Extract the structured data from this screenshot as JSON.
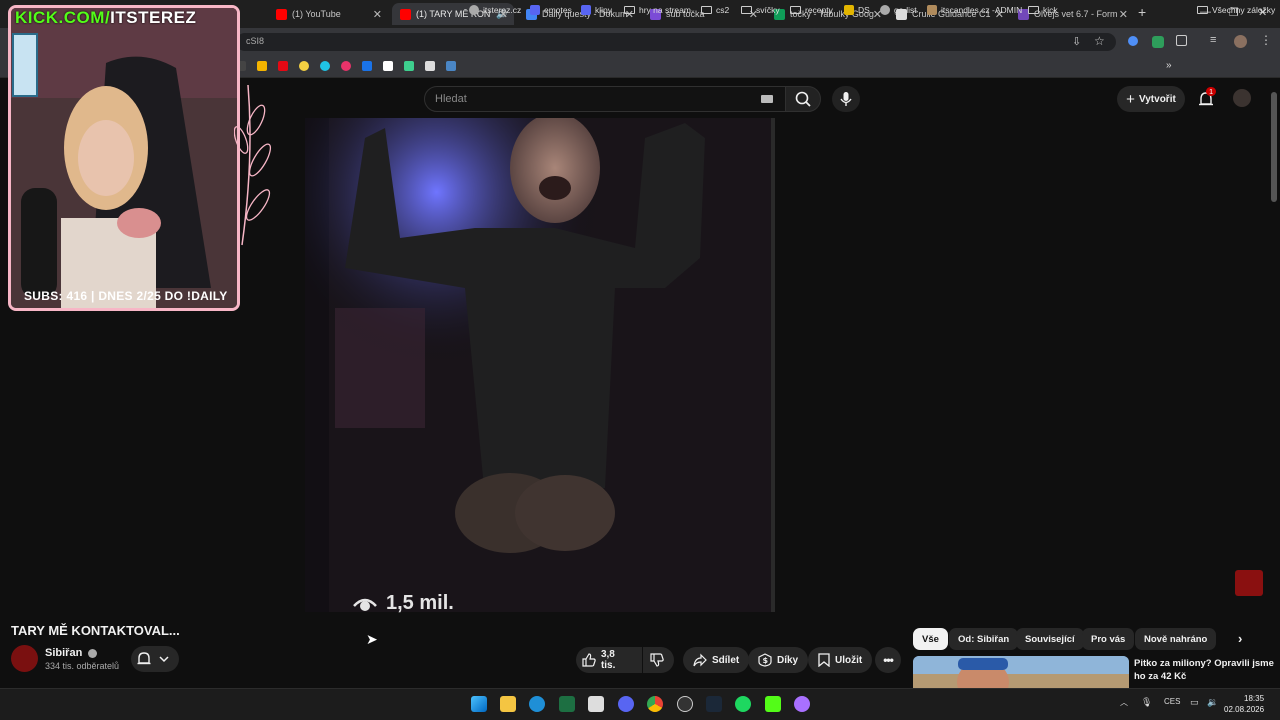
{
  "browser": {
    "tabs": [
      {
        "label": "(1) YouTube",
        "color": "#ff0000"
      },
      {
        "label": "(1) TARY MĚ KON",
        "color": "#ff0000",
        "active": true
      },
      {
        "label": "Daily questy - Dokum",
        "color": "#4285f4"
      },
      {
        "label": "sub točka",
        "color": "#7b4bd6"
      },
      {
        "label": "točky - Tabulky Goog",
        "color": "#0f9d58"
      },
      {
        "label": "Crullé Guidance C1",
        "color": "#dddddd"
      },
      {
        "label": "Olvejs vet 6.7 - Form",
        "color": "#7248b9"
      }
    ],
    "url": "cSI8",
    "bookmarks": [
      {
        "label": "itsterez.cz",
        "kind": "globe"
      },
      {
        "label": "emotes",
        "kind": "sl"
      },
      {
        "label": "klipy",
        "kind": "sl"
      },
      {
        "label": "hry na stream",
        "kind": "folder"
      },
      {
        "label": "cs2",
        "kind": "folder"
      },
      {
        "label": "svíčky",
        "kind": "folder"
      },
      {
        "label": "recepty",
        "kind": "folder"
      },
      {
        "label": "DS",
        "kind": "icon"
      },
      {
        "label": "ga-list",
        "kind": "globe"
      },
      {
        "label": "itscandles.cz -ADMIN",
        "kind": "icon"
      },
      {
        "label": "kick",
        "kind": "folder"
      }
    ],
    "all_bookmarks": "Všechny záložky"
  },
  "overlay": {
    "kick_prefix": "KICK.COM/",
    "kick_name": "ITSTEREZ",
    "subs_text": "SUBS: 416 | DNES 2/25 DO !DAILY"
  },
  "youtube": {
    "search_placeholder": "Hledat",
    "create_label": "Vytvořit",
    "notif_count": "1",
    "video_views": "1,5 mil.",
    "title": "TARY MĚ KONTAKTOVAL...",
    "channel": "Sibiřan",
    "channel_subs": "334 tis. odběratelů",
    "likes": "3,8 tis.",
    "share": "Sdílet",
    "thanks": "Díky",
    "save": "Uložit",
    "chips": [
      "Vše",
      "Od: Sibiřan",
      "Související",
      "Pro vás",
      "Nově nahráno"
    ],
    "rec_title": "Pitko za miliony? Opravili jsme ho za 42 Kč"
  },
  "taskbar": {
    "lang": "CES",
    "time": "18:35",
    "date": "02.08.2026"
  }
}
